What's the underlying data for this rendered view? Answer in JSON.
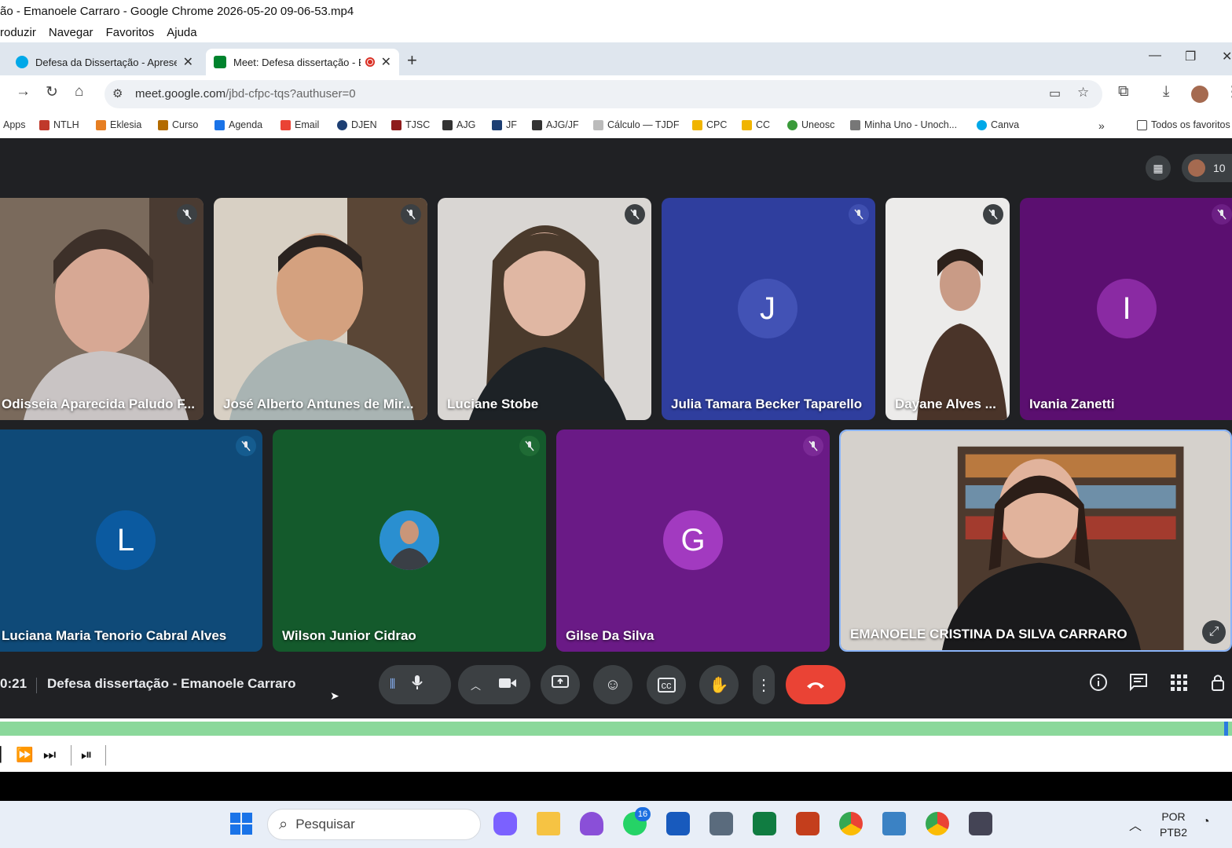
{
  "window": {
    "title": "ão - Emanoele Carraro - Google Chrome 2026-05-20 09-06-53.mp4"
  },
  "menu": [
    "roduzir",
    "Navegar",
    "Favoritos",
    "Ajuda"
  ],
  "tabs": [
    {
      "title": "Defesa da Dissertação - Apresen"
    },
    {
      "title": "Meet: Defesa dissertação - E"
    }
  ],
  "address": {
    "host": "meet.google.com",
    "path": "/jbd-cfpc-tqs?authuser=0"
  },
  "bookmarks": [
    "Apps",
    "NTLH",
    "Eklesia",
    "Curso",
    "Agenda",
    "Email",
    "DJEN",
    "TJSC",
    "AJG",
    "JF",
    "AJG/JF",
    "Cálculo — TJDF",
    "CPC",
    "CC",
    "Uneosc",
    "Minha Uno - Unoch...",
    "Canva"
  ],
  "bookmarks_all": "Todos os favoritos",
  "meet": {
    "participant_count": "10",
    "participants": [
      {
        "name": "Odisseia Aparecida Paludo F..."
      },
      {
        "name": "José Alberto Antunes de Mir..."
      },
      {
        "name": "Luciane Stobe"
      },
      {
        "name": "Julia Tamara Becker Taparello",
        "initial": "J"
      },
      {
        "name": "Dayane Alves ..."
      },
      {
        "name": "Ivania Zanetti",
        "initial": "I"
      },
      {
        "name": "Luciana Maria Tenorio Cabral Alves",
        "initial": "L"
      },
      {
        "name": "Wilson Junior Cidrao"
      },
      {
        "name": "Gilse Da Silva",
        "initial": "G"
      },
      {
        "name": "EMANOELE CRISTINA DA SILVA CARRARO"
      }
    ],
    "time": "0:21",
    "meeting_title": "Defesa dissertação - Emanoele Carraro"
  },
  "taskbar": {
    "search_placeholder": "Pesquisar",
    "whatsapp_badge": "16",
    "lang1": "POR",
    "lang2": "PTB2"
  },
  "colors": {
    "meet_bg": "#202124",
    "end_call": "#ea4335",
    "seek": "#8bd89b"
  }
}
